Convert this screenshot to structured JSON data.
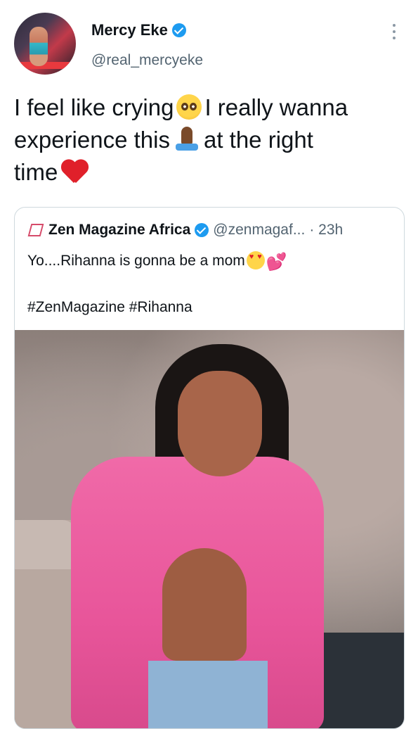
{
  "tweet": {
    "author_name": "Mercy Eke",
    "author_handle": "@real_mercyeke",
    "line1_before": "I feel like crying",
    "line1_after": "I really wanna",
    "line2_before": "experience this",
    "line2_after": "at the right",
    "line3": "time",
    "emojis": [
      "pleading-face-icon",
      "folded-hands-icon",
      "red-heart-icon"
    ]
  },
  "quoted": {
    "name": "Zen Magazine Africa",
    "handle": "@zenmagaf...",
    "time": "· 23h",
    "text": "Yo....Rihanna is gonna be a mom",
    "hashtags": "#ZenMagazine #Rihanna",
    "emojis": [
      "heart-eyes-icon",
      "two-hearts-icon"
    ]
  },
  "colors": {
    "verified": "#1d9bf0",
    "text_primary": "#0f1419",
    "text_secondary": "#536471",
    "jacket_pink": "#e8559a"
  }
}
